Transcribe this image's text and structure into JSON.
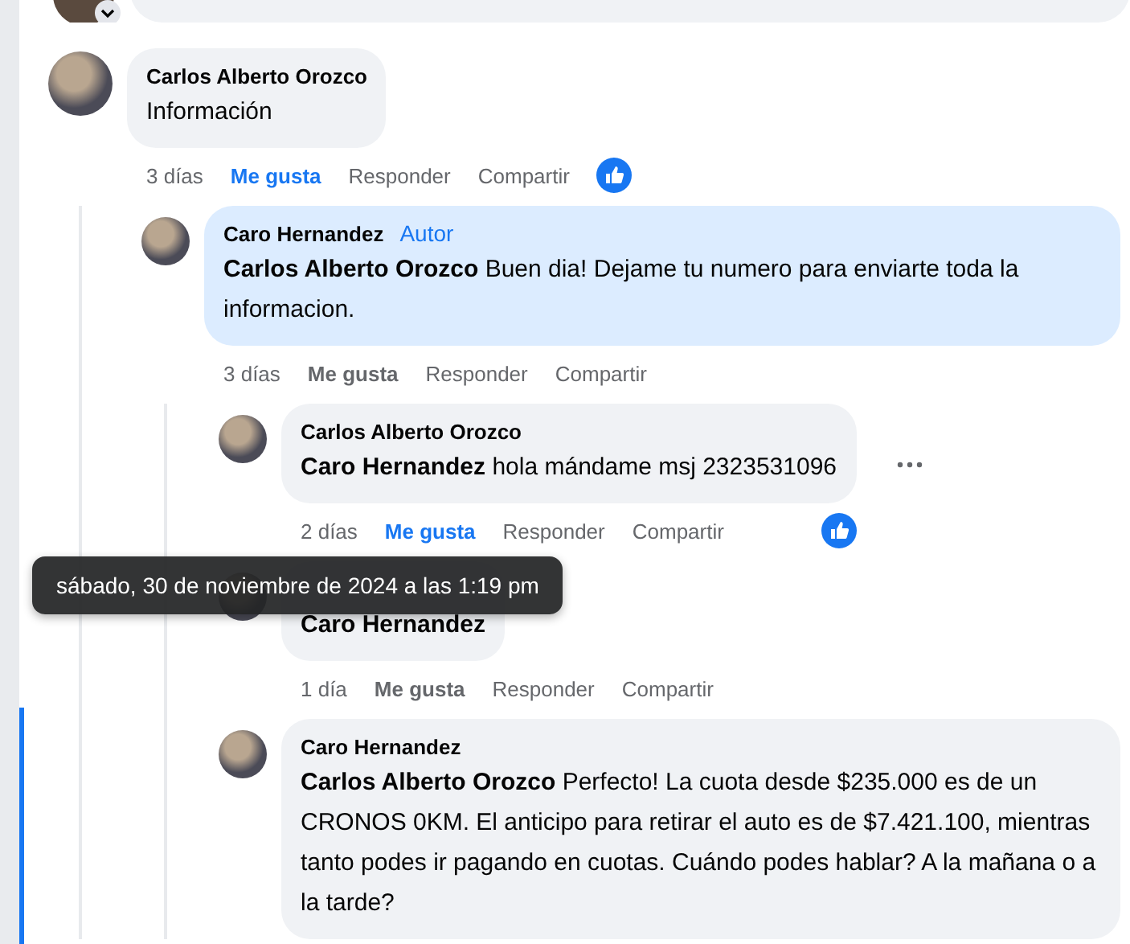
{
  "comments": [
    {
      "author": "Carlos Alberto Orozco",
      "text": "Información",
      "time": "3 días",
      "actions": [
        "Me gusta",
        "Responder",
        "Compartir"
      ],
      "liked": true,
      "reacted": true,
      "highlighted": false,
      "menu_shown": false,
      "children": [
        {
          "author": "Caro Hernandez",
          "badge": "Autor",
          "mention": "Carlos Alberto Orozco",
          "text": "Buen dia! Dejame tu numero para enviarte toda la informacion.",
          "time": "3 días",
          "actions": [
            "Me gusta",
            "Responder",
            "Compartir"
          ],
          "liked": false,
          "reacted": false,
          "highlighted": true,
          "menu_shown": false,
          "children": [
            {
              "author": "Carlos Alberto Orozco",
              "mention": "Caro Hernandez",
              "text": "hola mándame msj 2323531096",
              "time": "2 días",
              "actions": [
                "Me gusta",
                "Responder",
                "Compartir"
              ],
              "liked": true,
              "reacted": true,
              "highlighted": false,
              "menu_shown": true
            },
            {
              "mention": "Caro Hernandez",
              "time": "1 día",
              "actions": [
                "Me gusta",
                "Responder",
                "Compartir"
              ],
              "liked": false,
              "reacted": false,
              "highlighted": false,
              "menu_shown": false
            },
            {
              "author": "Caro Hernandez",
              "mention": "Carlos Alberto Orozco",
              "text": "Perfecto! La cuota desde $235.000 es de un CRONOS 0KM. El anticipo para retirar el auto es de $7.421.100, mientras tanto podes ir pagando en cuotas. Cuándo podes hablar? A la mañana o a la tarde?",
              "highlighted": false,
              "menu_shown": false
            }
          ]
        }
      ]
    }
  ],
  "tooltip": {
    "text": "sábado, 30 de noviembre de 2024 a las 1:19 pm"
  }
}
